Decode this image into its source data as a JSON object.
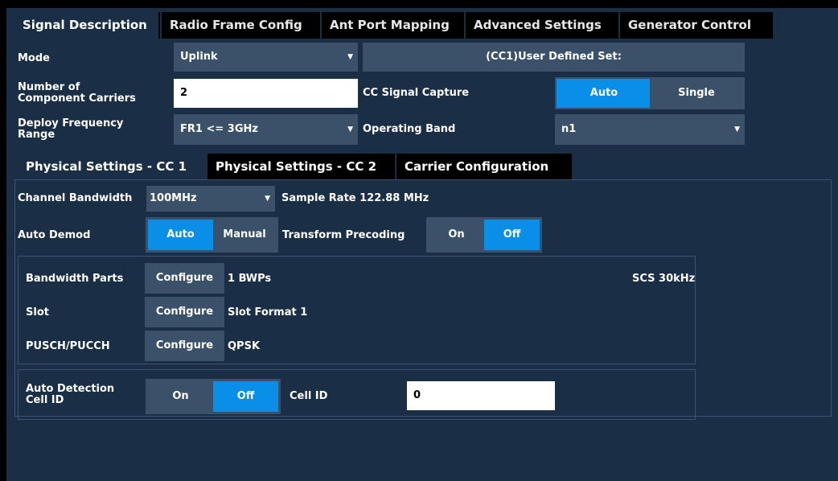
{
  "tabs": [
    {
      "label": "Signal Description",
      "active": true
    },
    {
      "label": "Radio Frame Config",
      "active": false
    },
    {
      "label": "Ant Port Mapping",
      "active": false
    },
    {
      "label": "Advanced Settings",
      "active": false
    },
    {
      "label": "Generator Control",
      "active": false
    }
  ],
  "signal": {
    "mode_label": "Mode",
    "mode_value": "Uplink",
    "user_defined_set": "(CC1)User Defined Set:",
    "num_cc_label_1": "Number of",
    "num_cc_label_2": "Component Carriers",
    "num_cc_value": "2",
    "cc_capture_label": "CC Signal Capture",
    "cc_capture_auto": "Auto",
    "cc_capture_single": "Single",
    "deploy_label_1": "Deploy Frequency",
    "deploy_label_2": "Range",
    "deploy_value": "FR1 <= 3GHz",
    "operating_band_label": "Operating Band",
    "operating_band_value": "n1"
  },
  "subtabs": [
    {
      "label": "Physical Settings - CC 1",
      "active": true
    },
    {
      "label": "Physical Settings - CC 2",
      "active": false
    },
    {
      "label": "Carrier Configuration",
      "active": false
    }
  ],
  "physical": {
    "channel_bw_label": "Channel Bandwidth",
    "channel_bw_value": "100MHz",
    "sample_rate": "Sample Rate 122.88 MHz",
    "auto_demod_label": "Auto Demod",
    "auto_demod_auto": "Auto",
    "auto_demod_manual": "Manual",
    "transform_label": "Transform Precoding",
    "transform_on": "On",
    "transform_off": "Off",
    "bwp_label": "Bandwidth Parts",
    "bwp_configure": "Configure",
    "bwp_value": "1 BWPs",
    "scs": "SCS 30kHz",
    "slot_label": "Slot",
    "slot_configure": "Configure",
    "slot_value": "Slot Format 1",
    "pusch_label": "PUSCH/PUCCH",
    "pusch_configure": "Configure",
    "pusch_value": "QPSK",
    "autodet_label_1": "Auto Detection",
    "autodet_label_2": "Cell ID",
    "autodet_on": "On",
    "autodet_off": "Off",
    "cell_id_label": "Cell ID",
    "cell_id_value": "0"
  },
  "colors": {
    "panel": "#1a2f45",
    "field": "#3b5169",
    "accent": "#0a8fe8"
  }
}
